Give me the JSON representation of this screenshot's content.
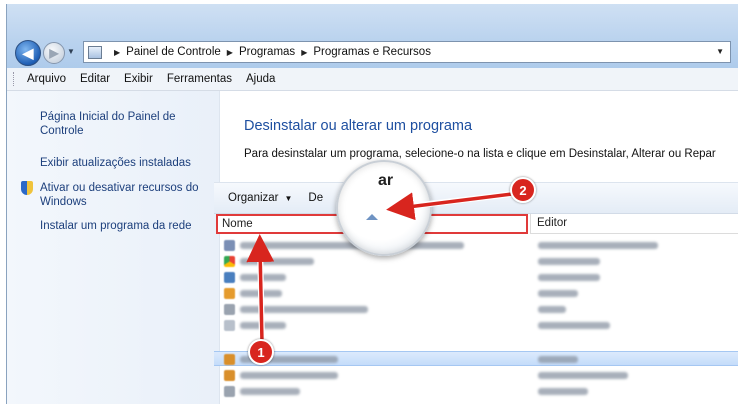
{
  "address": {
    "crumbs": [
      "Painel de Controle",
      "Programas",
      "Programas e Recursos"
    ]
  },
  "menu": [
    "Arquivo",
    "Editar",
    "Exibir",
    "Ferramentas",
    "Ajuda"
  ],
  "left_pane": {
    "home_link": "Página Inicial do Painel de Controle",
    "updates_link": "Exibir atualizações instaladas",
    "features_link": "Ativar ou desativar recursos do Windows",
    "network_install_link": "Instalar um programa da rede"
  },
  "main": {
    "title": "Desinstalar ou alterar um programa",
    "description": "Para desinstalar um programa, selecione-o na lista e clique em Desinstalar, Alterar ou Repar",
    "toolbar": {
      "organize": "Organizar",
      "uninstall_partial": "De"
    },
    "columns": {
      "name": "Nome",
      "editor": "Editor"
    },
    "magnifier_text": "ar"
  },
  "callouts": {
    "one": "1",
    "two": "2"
  },
  "colors": {
    "callout": "#d8251e",
    "highlight_box": "#e03a3a",
    "link": "#1c3f7c",
    "title": "#1e4fa0"
  },
  "icons": [
    "back-arrow-icon",
    "forward-arrow-icon",
    "control-panel-icon",
    "shield-icon",
    "sort-ascending-icon"
  ]
}
